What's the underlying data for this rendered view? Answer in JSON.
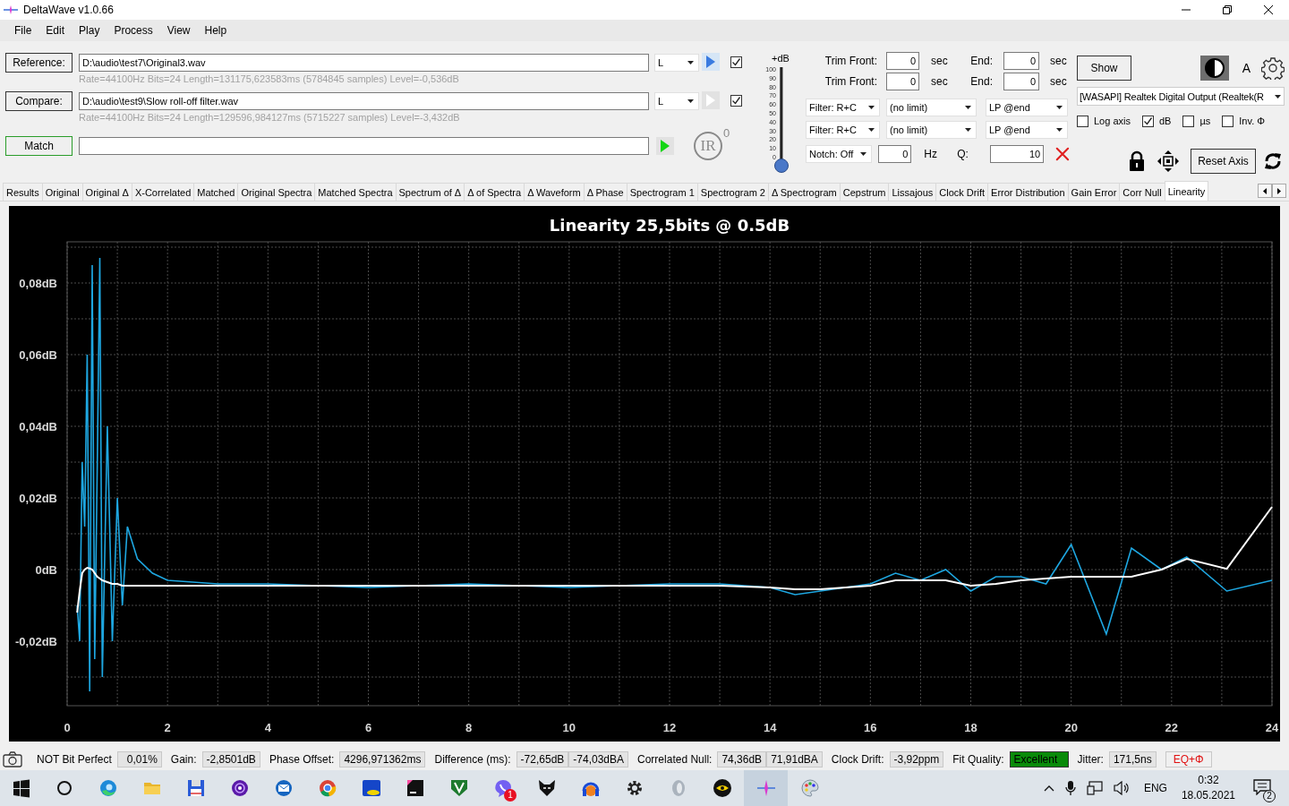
{
  "window": {
    "title": "DeltaWave v1.0.66"
  },
  "menu": [
    {
      "label": "File"
    },
    {
      "label": "Edit"
    },
    {
      "label": "Play"
    },
    {
      "label": "Process"
    },
    {
      "label": "View"
    },
    {
      "label": "Help"
    }
  ],
  "sources": [
    {
      "button": "Reference:",
      "path": "D:\\audio\\test7\\Original3.wav",
      "info": "Rate=44100Hz Bits=24 Length=131175,623583ms (5784845 samples) Level=-0,536dB",
      "channel": "L",
      "play_enabled": true,
      "checked": true
    },
    {
      "button": "Compare:",
      "path": "D:\\audio\\test9\\Slow roll-off filter.wav",
      "info": "Rate=44100Hz Bits=24 Length=129596,984127ms (5715227 samples) Level=-3,432dB",
      "channel": "L",
      "play_enabled": false,
      "checked": true
    }
  ],
  "match": {
    "button": "Match",
    "ir_label": "IR",
    "ir_count": "0"
  },
  "gain_slider": {
    "label": "+dB",
    "ticks": [
      "100",
      "90",
      "80",
      "70",
      "60",
      "50",
      "40",
      "30",
      "20",
      "10",
      "0"
    ],
    "level": 0
  },
  "trim": [
    {
      "label": "Trim Front:",
      "value": "0",
      "unit": "sec",
      "end_label": "End:",
      "end_value": "0",
      "end_unit": "sec"
    },
    {
      "label": "Trim Front:",
      "value": "0",
      "unit": "sec",
      "end_label": "End:",
      "end_value": "0",
      "end_unit": "sec"
    }
  ],
  "filters": [
    {
      "filter": "Filter: R+C",
      "limit": "(no limit)",
      "lowpass": "LP @end"
    },
    {
      "filter": "Filter: R+C",
      "limit": "(no limit)",
      "lowpass": "LP @end"
    }
  ],
  "notch": {
    "mode": "Notch: Off",
    "frequency": "0",
    "unit": "Hz",
    "q_label": "Q:",
    "q": "10"
  },
  "display": {
    "show_button": "Show",
    "font_label": "A",
    "device": "[WASAPI] Realtek Digital Output (Realtek(R",
    "options": [
      {
        "label": "Log axis",
        "checked": false
      },
      {
        "label": "dB",
        "checked": true
      },
      {
        "label": "µs",
        "checked": false
      },
      {
        "label": "Inv. Φ",
        "checked": false
      }
    ],
    "reset_button": "Reset Axis"
  },
  "tabs": [
    {
      "label": "Results",
      "selected": false
    },
    {
      "label": "Original",
      "selected": false
    },
    {
      "label": "Original Δ",
      "selected": false
    },
    {
      "label": "X-Correlated",
      "selected": false
    },
    {
      "label": "Matched",
      "selected": false
    },
    {
      "label": "Original Spectra",
      "selected": false
    },
    {
      "label": "Matched Spectra",
      "selected": false
    },
    {
      "label": "Spectrum of Δ",
      "selected": false
    },
    {
      "label": "Δ of Spectra",
      "selected": false
    },
    {
      "label": "Δ Waveform",
      "selected": false
    },
    {
      "label": "Δ Phase",
      "selected": false
    },
    {
      "label": "Spectrogram 1",
      "selected": false
    },
    {
      "label": "Spectrogram 2",
      "selected": false
    },
    {
      "label": "Δ Spectrogram",
      "selected": false
    },
    {
      "label": "Cepstrum",
      "selected": false
    },
    {
      "label": "Lissajous",
      "selected": false
    },
    {
      "label": "Clock Drift",
      "selected": false
    },
    {
      "label": "Error Distribution",
      "selected": false
    },
    {
      "label": "Gain Error",
      "selected": false
    },
    {
      "label": "Corr Null",
      "selected": false
    },
    {
      "label": "Linearity",
      "selected": true
    }
  ],
  "chart": {
    "chart_data": {
      "type": "line",
      "title": "Linearity 25,5bits @ 0.5dB",
      "x": [
        0.2,
        0.25,
        0.3,
        0.35,
        0.4,
        0.45,
        0.5,
        0.55,
        0.6,
        0.65,
        0.7,
        0.8,
        0.9,
        1.0,
        1.1,
        1.2,
        1.4,
        1.7,
        2,
        3,
        4,
        6,
        8,
        10,
        12,
        13,
        14,
        14.5,
        15,
        16,
        16.5,
        17,
        17.5,
        18,
        18.5,
        19,
        19.5,
        20,
        20.7,
        21.2,
        21.8,
        22.3,
        23.1,
        24
      ],
      "series": [
        {
          "color": "#1ea7e1",
          "values": [
            -0.01,
            -0.02,
            0.03,
            0.012,
            0.06,
            -0.034,
            0.085,
            -0.025,
            0.03,
            0.087,
            -0.03,
            0.04,
            -0.02,
            0.02,
            -0.01,
            0.012,
            0.003,
            -0.001,
            -0.003,
            -0.004,
            -0.004,
            -0.005,
            -0.004,
            -0.005,
            -0.004,
            -0.004,
            -0.005,
            -0.007,
            -0.006,
            -0.004,
            -0.001,
            -0.003,
            0.0,
            -0.006,
            -0.002,
            -0.002,
            -0.004,
            0.007,
            -0.018,
            0.006,
            0.0,
            0.0035,
            -0.006,
            -0.003
          ]
        },
        {
          "color": "#ffffff",
          "values": [
            -0.012,
            -0.006,
            -0.001,
            0.0,
            0.0005,
            0.0003,
            0.0,
            -0.001,
            -0.002,
            -0.0025,
            -0.003,
            -0.0035,
            -0.004,
            -0.004,
            -0.0045,
            -0.0045,
            -0.0045,
            -0.0045,
            -0.0045,
            -0.0045,
            -0.0045,
            -0.0045,
            -0.0045,
            -0.0045,
            -0.0045,
            -0.0045,
            -0.005,
            -0.0055,
            -0.0055,
            -0.0045,
            -0.003,
            -0.003,
            -0.003,
            -0.0045,
            -0.004,
            -0.003,
            -0.0025,
            -0.002,
            -0.002,
            -0.002,
            0.0,
            0.003,
            0.0002,
            0.0175
          ]
        }
      ],
      "grid": true,
      "xlim": [
        0,
        24
      ],
      "ylim": [
        -0.038,
        0.0915
      ],
      "xticks": [
        0,
        2,
        4,
        6,
        8,
        10,
        12,
        14,
        16,
        18,
        20,
        22,
        24
      ],
      "yticks": [
        {
          "value": -0.02,
          "label": "-0,02dB"
        },
        {
          "value": 0,
          "label": "0dB"
        },
        {
          "value": 0.02,
          "label": "0,02dB"
        },
        {
          "value": 0.04,
          "label": "0,04dB"
        },
        {
          "value": 0.06,
          "label": "0,06dB"
        },
        {
          "value": 0.08,
          "label": "0,08dB"
        }
      ]
    }
  },
  "status_bar": {
    "items": [
      {
        "label": "NOT Bit Perfect",
        "values": [
          "0,01%"
        ],
        "kind": "reading"
      },
      {
        "label": "Gain:",
        "values": [
          "-2,8501dB"
        ],
        "kind": "reading"
      },
      {
        "label": "Phase Offset:",
        "values": [
          "4296,971362ms"
        ],
        "kind": "reading"
      },
      {
        "label": "Difference (ms):",
        "values": [
          "-72,65dB",
          "-74,03dBA"
        ],
        "kind": "reading"
      },
      {
        "label": "Correlated Null:",
        "values": [
          "74,36dB",
          "71,91dBA"
        ],
        "kind": "reading"
      },
      {
        "label": "Clock Drift:",
        "values": [
          "-3,92ppm"
        ],
        "kind": "reading"
      },
      {
        "label": "Fit Quality:",
        "values": [
          "Excellent"
        ],
        "kind": "rating"
      },
      {
        "label": "Jitter:",
        "values": [
          "171,5ns"
        ],
        "kind": "reading"
      }
    ],
    "eq_button": "EQ+Φ"
  },
  "taskbar": {
    "app_badge": "1",
    "language": "ENG",
    "time": "0:32",
    "date": "18.05.2021",
    "notifications": "2"
  }
}
